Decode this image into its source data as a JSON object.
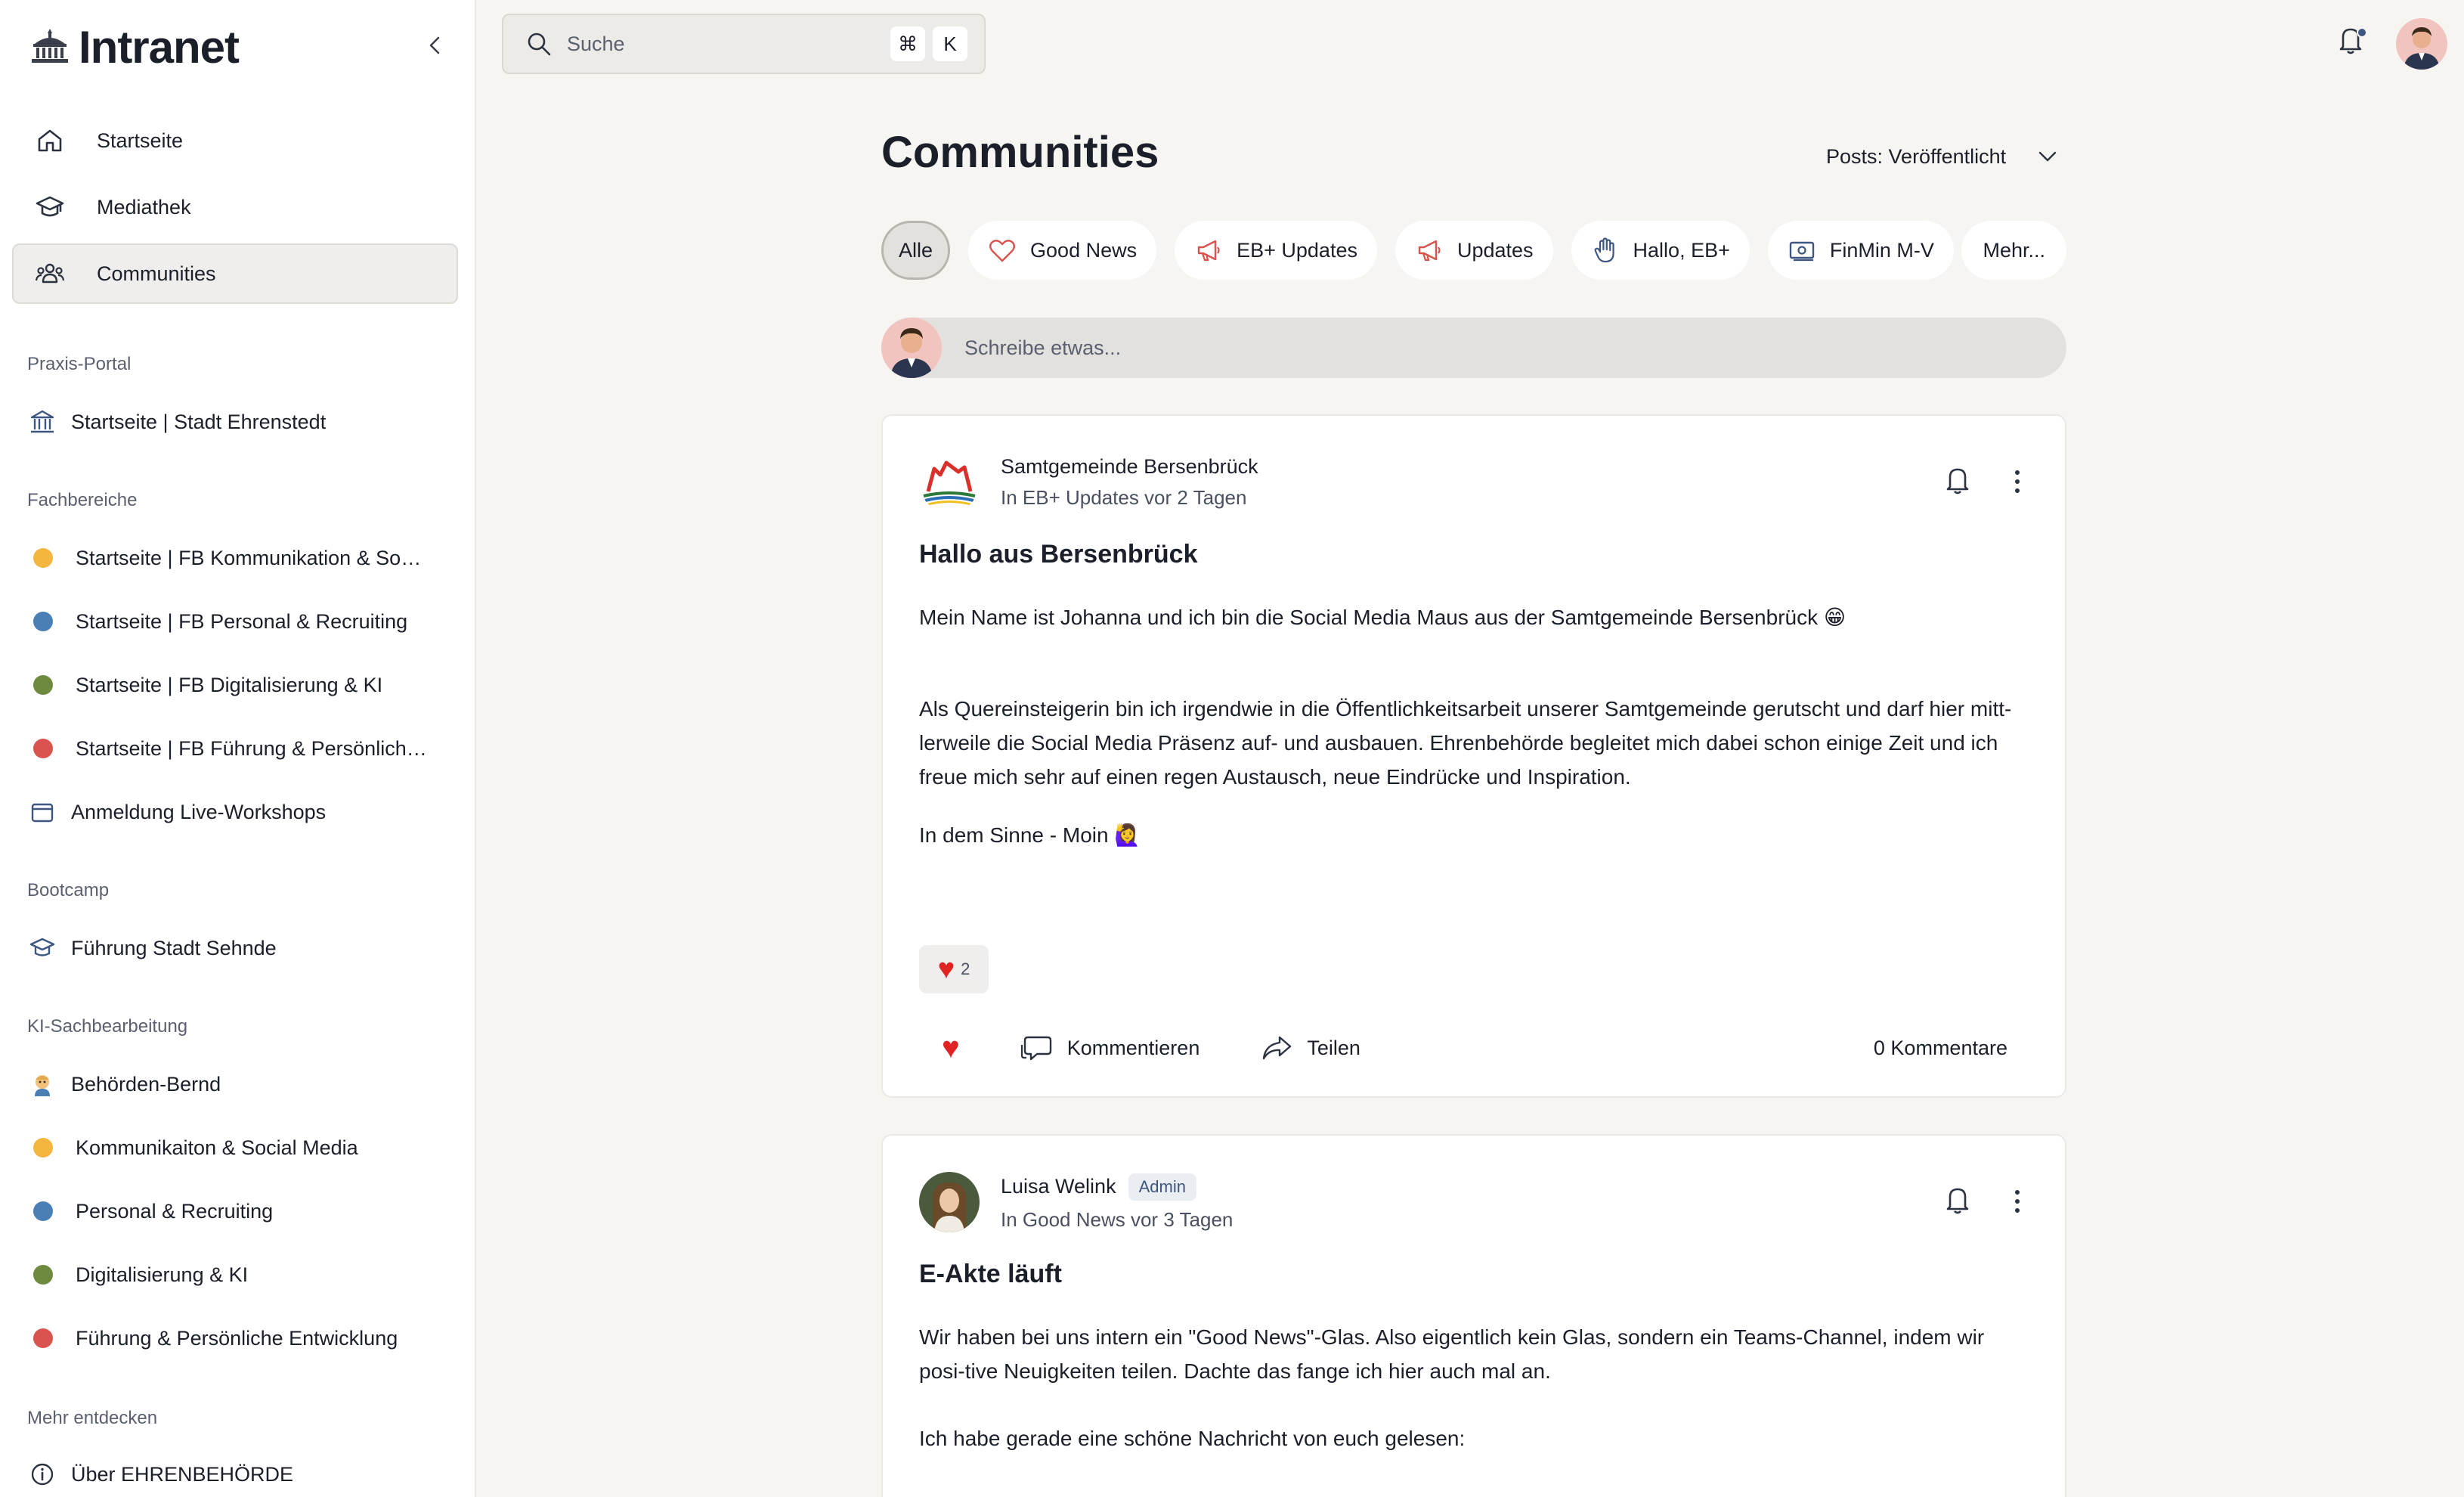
{
  "brand": {
    "name": "Intranet"
  },
  "nav": [
    {
      "label": "Startseite",
      "icon": "home-icon"
    },
    {
      "label": "Mediathek",
      "icon": "graduation-cap-icon"
    },
    {
      "label": "Communities",
      "icon": "users-icon",
      "active": true
    }
  ],
  "sections": {
    "praxis": {
      "label": "Praxis-Portal",
      "items": [
        {
          "label": "Startseite | Stadt Ehrenstedt",
          "icon": "town-hall-icon"
        }
      ]
    },
    "fachbereiche": {
      "label": "Fachbereiche",
      "items": [
        {
          "label": "Startseite | FB Kommunikation & Social Media",
          "color": "#f4b63f"
        },
        {
          "label": "Startseite | FB Personal & Recruiting",
          "color": "#4a7fb5"
        },
        {
          "label": "Startseite | FB Digitalisierung & KI",
          "color": "#6e8a3e"
        },
        {
          "label": "Startseite | FB Führung & Persönliche Entwicklung",
          "color": "#d9534f"
        },
        {
          "label": "Anmeldung Live-Workshops",
          "icon": "archive-box-icon"
        }
      ]
    },
    "bootcamp": {
      "label": "Bootcamp",
      "items": [
        {
          "label": "Führung Stadt Sehnde",
          "icon": "graduation-cap-icon"
        }
      ]
    },
    "ki": {
      "label": "KI-Sachbearbeitung",
      "items": [
        {
          "label": "Behörden-Bernd",
          "icon": "person-emoji-icon"
        },
        {
          "label": "Kommunikaiton & Social Media",
          "color": "#f4b63f"
        },
        {
          "label": "Personal & Recruiting",
          "color": "#4a7fb5"
        },
        {
          "label": "Digitalisierung & KI",
          "color": "#6e8a3e"
        },
        {
          "label": "Führung & Persönliche Entwicklung",
          "color": "#d9534f"
        }
      ]
    },
    "mehr": {
      "label": "Mehr entdecken",
      "items": [
        {
          "label": "Über EHRENBEHÖRDE",
          "icon": "info-icon"
        }
      ]
    }
  },
  "search": {
    "placeholder": "Suche",
    "shortcut": [
      "⌘",
      "K"
    ]
  },
  "main": {
    "title": "Communities",
    "filter": "Posts: Veröffentlicht",
    "chips": [
      {
        "label": "Alle",
        "active": true
      },
      {
        "label": "Good News",
        "icon": "heart-outline-icon"
      },
      {
        "label": "EB+ Updates",
        "icon": "megaphone-icon"
      },
      {
        "label": "Updates",
        "icon": "megaphone-icon"
      },
      {
        "label": "Hallo, EB+",
        "icon": "hand-icon"
      },
      {
        "label": "FinMin M-V",
        "icon": "money-icon"
      }
    ],
    "more_label": "Mehr...",
    "composer_placeholder": "Schreibe etwas..."
  },
  "posts": [
    {
      "author": "Samtgemeinde Bersenbrück",
      "where": "In EB+ Updates vor 2 Tagen",
      "title": "Hallo aus Bersenbrück",
      "paragraphs": [
        "Mein Name ist Johanna und ich bin die Social Media Maus aus der Samtgemeinde Bersenbrück 😁",
        "Als Quereinsteigerin bin ich irgendwie in die Öffentlichkeitsarbeit unserer Samtgemeinde gerutscht und darf hier mitt-lerweile die Social Media Präsenz auf- und ausbauen. Ehrenbehörde begleitet mich dabei schon einige Zeit und ich freue mich sehr auf einen regen Austausch, neue Eindrücke und Inspiration.",
        "In dem Sinne - Moin 🙋‍♀️"
      ],
      "reaction_count": "2",
      "comment_label": "Kommentieren",
      "share_label": "Teilen",
      "comments": "0 Kommentare"
    },
    {
      "author": "Luisa Welink",
      "badge": "Admin",
      "where": "In Good News vor 3 Tagen",
      "title": "E-Akte läuft",
      "paragraphs": [
        "Wir haben bei uns intern ein \"Good News\"-Glas. Also eigentlich kein Glas, sondern ein Teams-Channel, indem wir posi-tive Neuigkeiten teilen. Dachte das fange ich hier auch mal an.",
        "Ich habe gerade eine schöne Nachricht von euch gelesen:"
      ]
    }
  ],
  "colors": {
    "accent": "#3d5780",
    "heart": "#e02424",
    "page_bg": "#f7f5f2"
  }
}
